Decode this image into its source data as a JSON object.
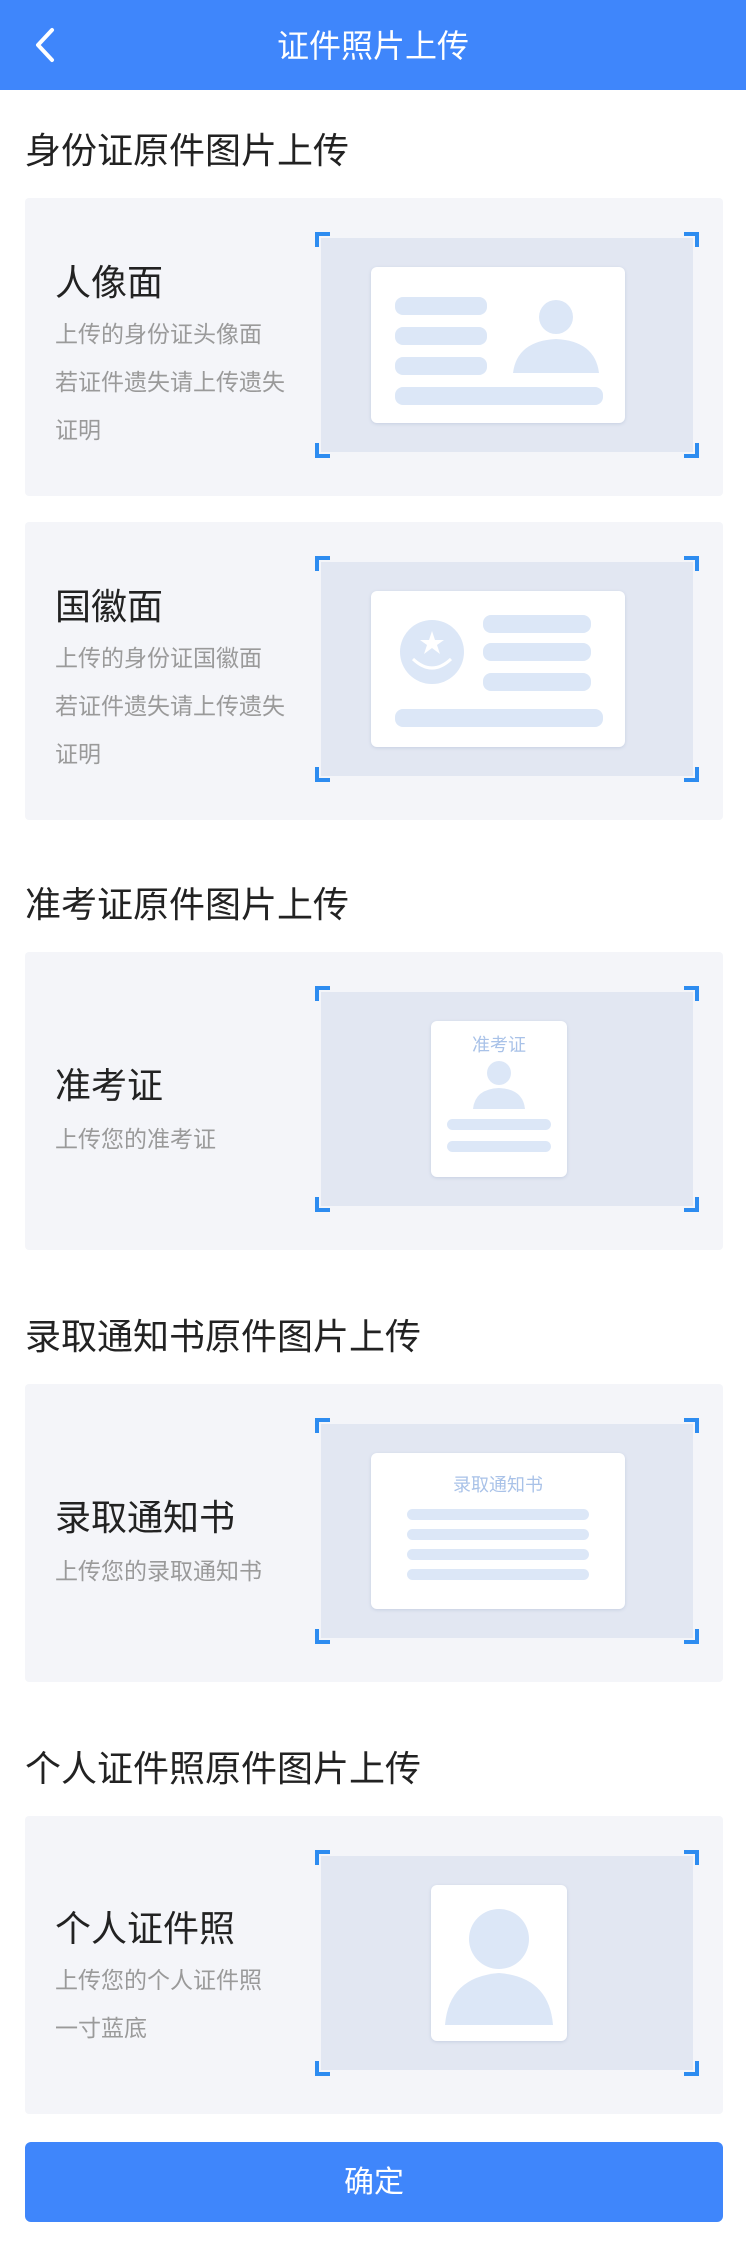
{
  "header": {
    "title": "证件照片上传"
  },
  "sections": [
    {
      "title": "身份证原件图片上传",
      "cards": [
        {
          "title": "人像面",
          "desc": [
            "上传的身份证头像面",
            "若证件遗失请上传遗失",
            "证明"
          ]
        },
        {
          "title": "国徽面",
          "desc": [
            "上传的身份证国徽面",
            "若证件遗失请上传遗失",
            "证明"
          ]
        }
      ]
    },
    {
      "title": "准考证原件图片上传",
      "cards": [
        {
          "title": "准考证",
          "desc": [
            "上传您的准考证"
          ],
          "doc_label": "准考证"
        }
      ]
    },
    {
      "title": "录取通知书原件图片上传",
      "cards": [
        {
          "title": "录取通知书",
          "desc": [
            "上传您的录取通知书"
          ],
          "doc_label": "录取通知书"
        }
      ]
    },
    {
      "title": "个人证件照原件图片上传",
      "cards": [
        {
          "title": "个人证件照",
          "desc": [
            "上传您的个人证件照",
            "一寸蓝底"
          ]
        }
      ]
    }
  ],
  "confirm_label": "确定",
  "colors": {
    "primary": "#3f86fb",
    "corner": "#2d8cf0",
    "card_bg": "#f4f5f9",
    "preview_bg": "#e2e7f2"
  }
}
